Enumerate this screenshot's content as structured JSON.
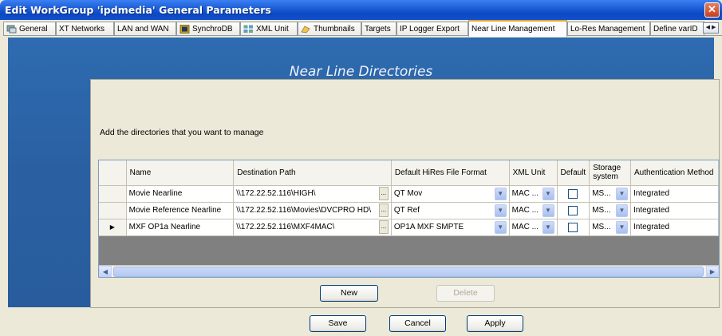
{
  "window": {
    "title": "Edit WorkGroup 'ipdmedia' General Parameters",
    "close_label": "✕"
  },
  "tabs": [
    {
      "label": "General",
      "icon": "general-icon"
    },
    {
      "label": "XT Networks"
    },
    {
      "label": "LAN and WAN"
    },
    {
      "label": "SynchroDB",
      "icon": "synchrodb-icon"
    },
    {
      "label": "XML Unit",
      "icon": "xml-unit-icon"
    },
    {
      "label": "Thumbnails",
      "icon": "thumbnails-icon"
    },
    {
      "label": "Targets"
    },
    {
      "label": "IP Logger Export"
    },
    {
      "label": "Near Line Management",
      "active": true
    },
    {
      "label": "Lo-Res Management"
    },
    {
      "label": "Define varID"
    }
  ],
  "panel": {
    "title": "Near Line Directories",
    "instructions": "Add the directories that you want to manage"
  },
  "grid": {
    "columns": [
      "Name",
      "Destination Path",
      "Default HiRes File Format",
      "XML Unit",
      "Default",
      "Storage system",
      "Authentication Method"
    ],
    "rows": [
      {
        "name": "Movie Nearline",
        "path": "\\\\172.22.52.116\\HIGH\\",
        "format": "QT Mov",
        "xml_unit": "MAC ...",
        "default": false,
        "storage": "MS...",
        "auth": "Integrated",
        "current": false
      },
      {
        "name": "Movie Reference Nearline",
        "path": "\\\\172.22.52.116\\Movies\\DVCPRO HD\\",
        "format": "QT Ref",
        "xml_unit": "MAC ...",
        "default": false,
        "storage": "MS...",
        "auth": "Integrated",
        "current": false
      },
      {
        "name": "MXF OP1a Nearline",
        "path": "\\\\172.22.52.116\\MXF4MAC\\",
        "format": "OP1A MXF SMPTE",
        "xml_unit": "MAC ...",
        "default": false,
        "storage": "MS...",
        "auth": "Integrated",
        "current": true
      }
    ],
    "ellipsis_label": "...",
    "current_row_marker": "▶"
  },
  "buttons": {
    "new": "New",
    "delete": "Delete",
    "save": "Save",
    "cancel": "Cancel",
    "apply": "Apply"
  },
  "colors": {
    "panel_blue": "#2a60a2",
    "active_tab_accent": "#e6a52f",
    "titlebar": "#1f5fd6"
  }
}
